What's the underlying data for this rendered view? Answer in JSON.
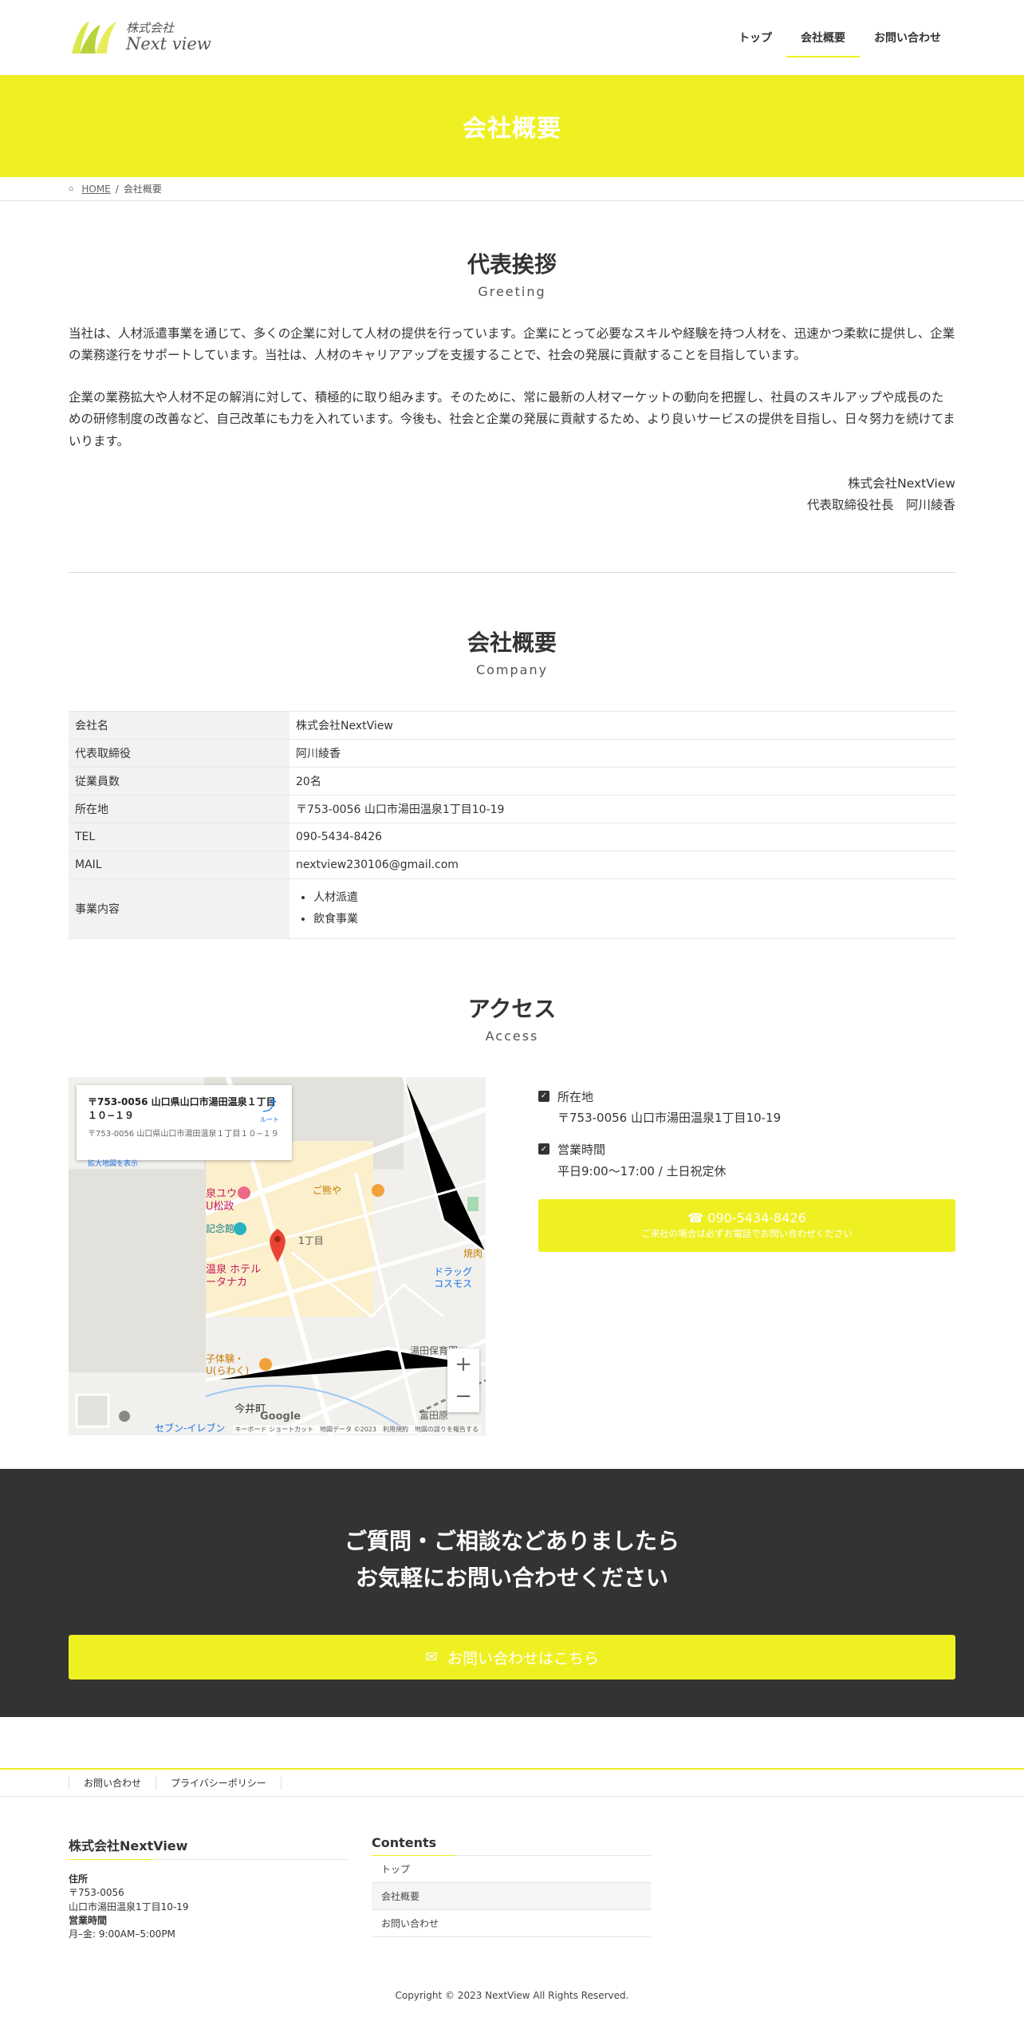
{
  "header": {
    "logo_small": "株式会社",
    "logo_big": "Next view",
    "nav": [
      "トップ",
      "会社概要",
      "お問い合わせ"
    ]
  },
  "page_title": "会社概要",
  "breadcrumb": {
    "home": "HOME",
    "separator": "/",
    "current": "会社概要"
  },
  "greeting": {
    "title": "代表挨拶",
    "subtitle": "Greeting",
    "paragraphs": [
      "当社は、人材派遣事業を通じて、多くの企業に対して人材の提供を行っています。企業にとって必要なスキルや経験を持つ人材を、迅速かつ柔軟に提供し、企業の業務遂行をサポートしています。当社は、人材のキャリアアップを支援することで、社会の発展に貢献することを目指しています。",
      "企業の業務拡大や人材不足の解消に対して、積極的に取り組みます。そのために、常に最新の人材マーケットの動向を把握し、社員のスキルアップや成長のための研修制度の改善など、自己改革にも力を入れています。今後も、社会と企業の発展に貢献するため、より良いサービスの提供を目指し、日々努力を続けてまいります。"
    ],
    "signature_company": "株式会社NextView",
    "signature_name": "代表取締役社長　阿川綾香"
  },
  "company": {
    "title": "会社概要",
    "subtitle": "Company",
    "rows": [
      {
        "label": "会社名",
        "value": "株式会社NextView"
      },
      {
        "label": "代表取締役",
        "value": "阿川綾香"
      },
      {
        "label": "従業員数",
        "value": "20名"
      },
      {
        "label": "所在地",
        "value": "〒753-0056 山口市湯田温泉1丁目10-19"
      },
      {
        "label": "TEL",
        "value": "090-5434-8426"
      },
      {
        "label": "MAIL",
        "value": "nextview230106@gmail.com"
      }
    ],
    "business_label": "事業内容",
    "business_items": [
      "人材派遣",
      "飲食事業"
    ]
  },
  "access": {
    "title": "アクセス",
    "subtitle": "Access",
    "map": {
      "card_title": "〒753-0056 山口県山口市湯田温泉１丁目１０−１９",
      "card_sub": "〒753-0056 山口県山口市湯田温泉１丁目１０−１９",
      "card_link": "拡大地図を表示",
      "directions": "ルート",
      "labels": [
        "ご熊や",
        "1丁目",
        "温泉 ホテル",
        "ータナカ",
        "今井町",
        "湯田保育園",
        "ドラッグ",
        "コスモス",
        "焼肉",
        "富田原",
        "セブン-イレブン",
        "泉ユウ",
        "U松政",
        "記念館",
        "子体験・",
        "U(らわく)"
      ],
      "brand": "Google",
      "footer": "キーボード ショートカット　地図データ ©2023　利用規約　地図の誤りを報告する",
      "zoom_in": "+",
      "zoom_out": "−"
    },
    "items": [
      {
        "label": "所在地",
        "value": "〒753-0056 山口市湯田温泉1丁目10-19"
      },
      {
        "label": "営業時間",
        "value": "平日9:00〜17:00 / 土日祝定休"
      }
    ],
    "tel_button": {
      "number": "090-5434-8426",
      "note": "ご来社の場合は必ずお電話でお問い合わせください"
    }
  },
  "cta": {
    "line1": "ご質問・ご相談などありましたら",
    "line2": "お気軽にお問い合わせください",
    "button": "お問い合わせはこちら"
  },
  "footer": {
    "nav": [
      "お問い合わせ",
      "プライバシーポリシー"
    ],
    "company_heading": "株式会社NextView",
    "address_label": "住所",
    "postal": "〒753-0056",
    "address": "山口市湯田温泉1丁目10-19",
    "hours_label": "営業時間",
    "hours": "月–金: 9:00AM–5:00PM",
    "contents_heading": "Contents",
    "contents_links": [
      "トップ",
      "会社概要",
      "お問い合わせ"
    ],
    "copyright": "Copyright © 2023 NextView All Rights Reserved."
  },
  "colors": {
    "accent": "#eff022",
    "dark": "#333333",
    "cell_bg": "#f2f2f2"
  },
  "icons": [
    "home-icon",
    "check-icon",
    "phone-icon",
    "mail-icon",
    "directions-icon",
    "map-pin-icon"
  ]
}
